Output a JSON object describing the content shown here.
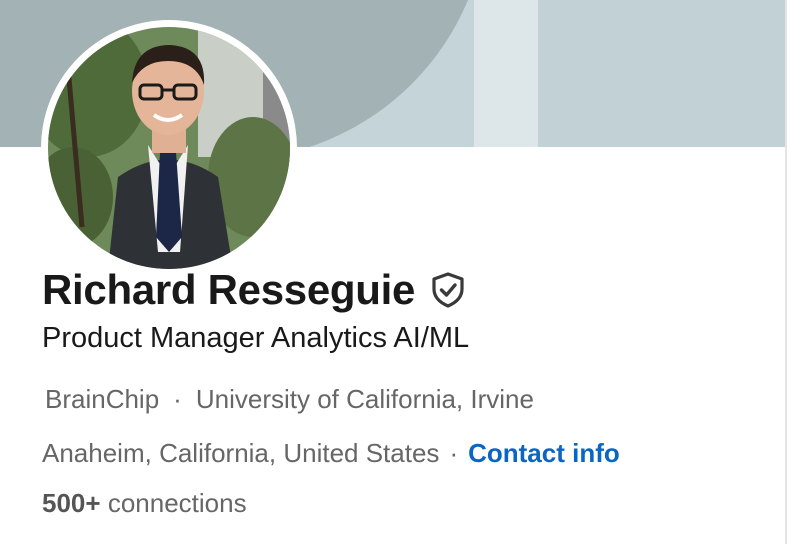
{
  "profile": {
    "name": "Richard Resseguie",
    "headline": "Product Manager Analytics AI/ML",
    "company": "BrainChip",
    "school": "University of California, Irvine",
    "location": "Anaheim, California, United States",
    "contact_label": "Contact info",
    "connections_count": "500+",
    "connections_label": "connections",
    "separator": "·"
  },
  "icons": {
    "verified": "verified-shield-icon"
  },
  "colors": {
    "link": "#0a66c2",
    "name_text": "#191919",
    "secondary_text": "#666666",
    "banner_dark": "#a3b2b4",
    "banner_light": "#c4d4d8"
  }
}
